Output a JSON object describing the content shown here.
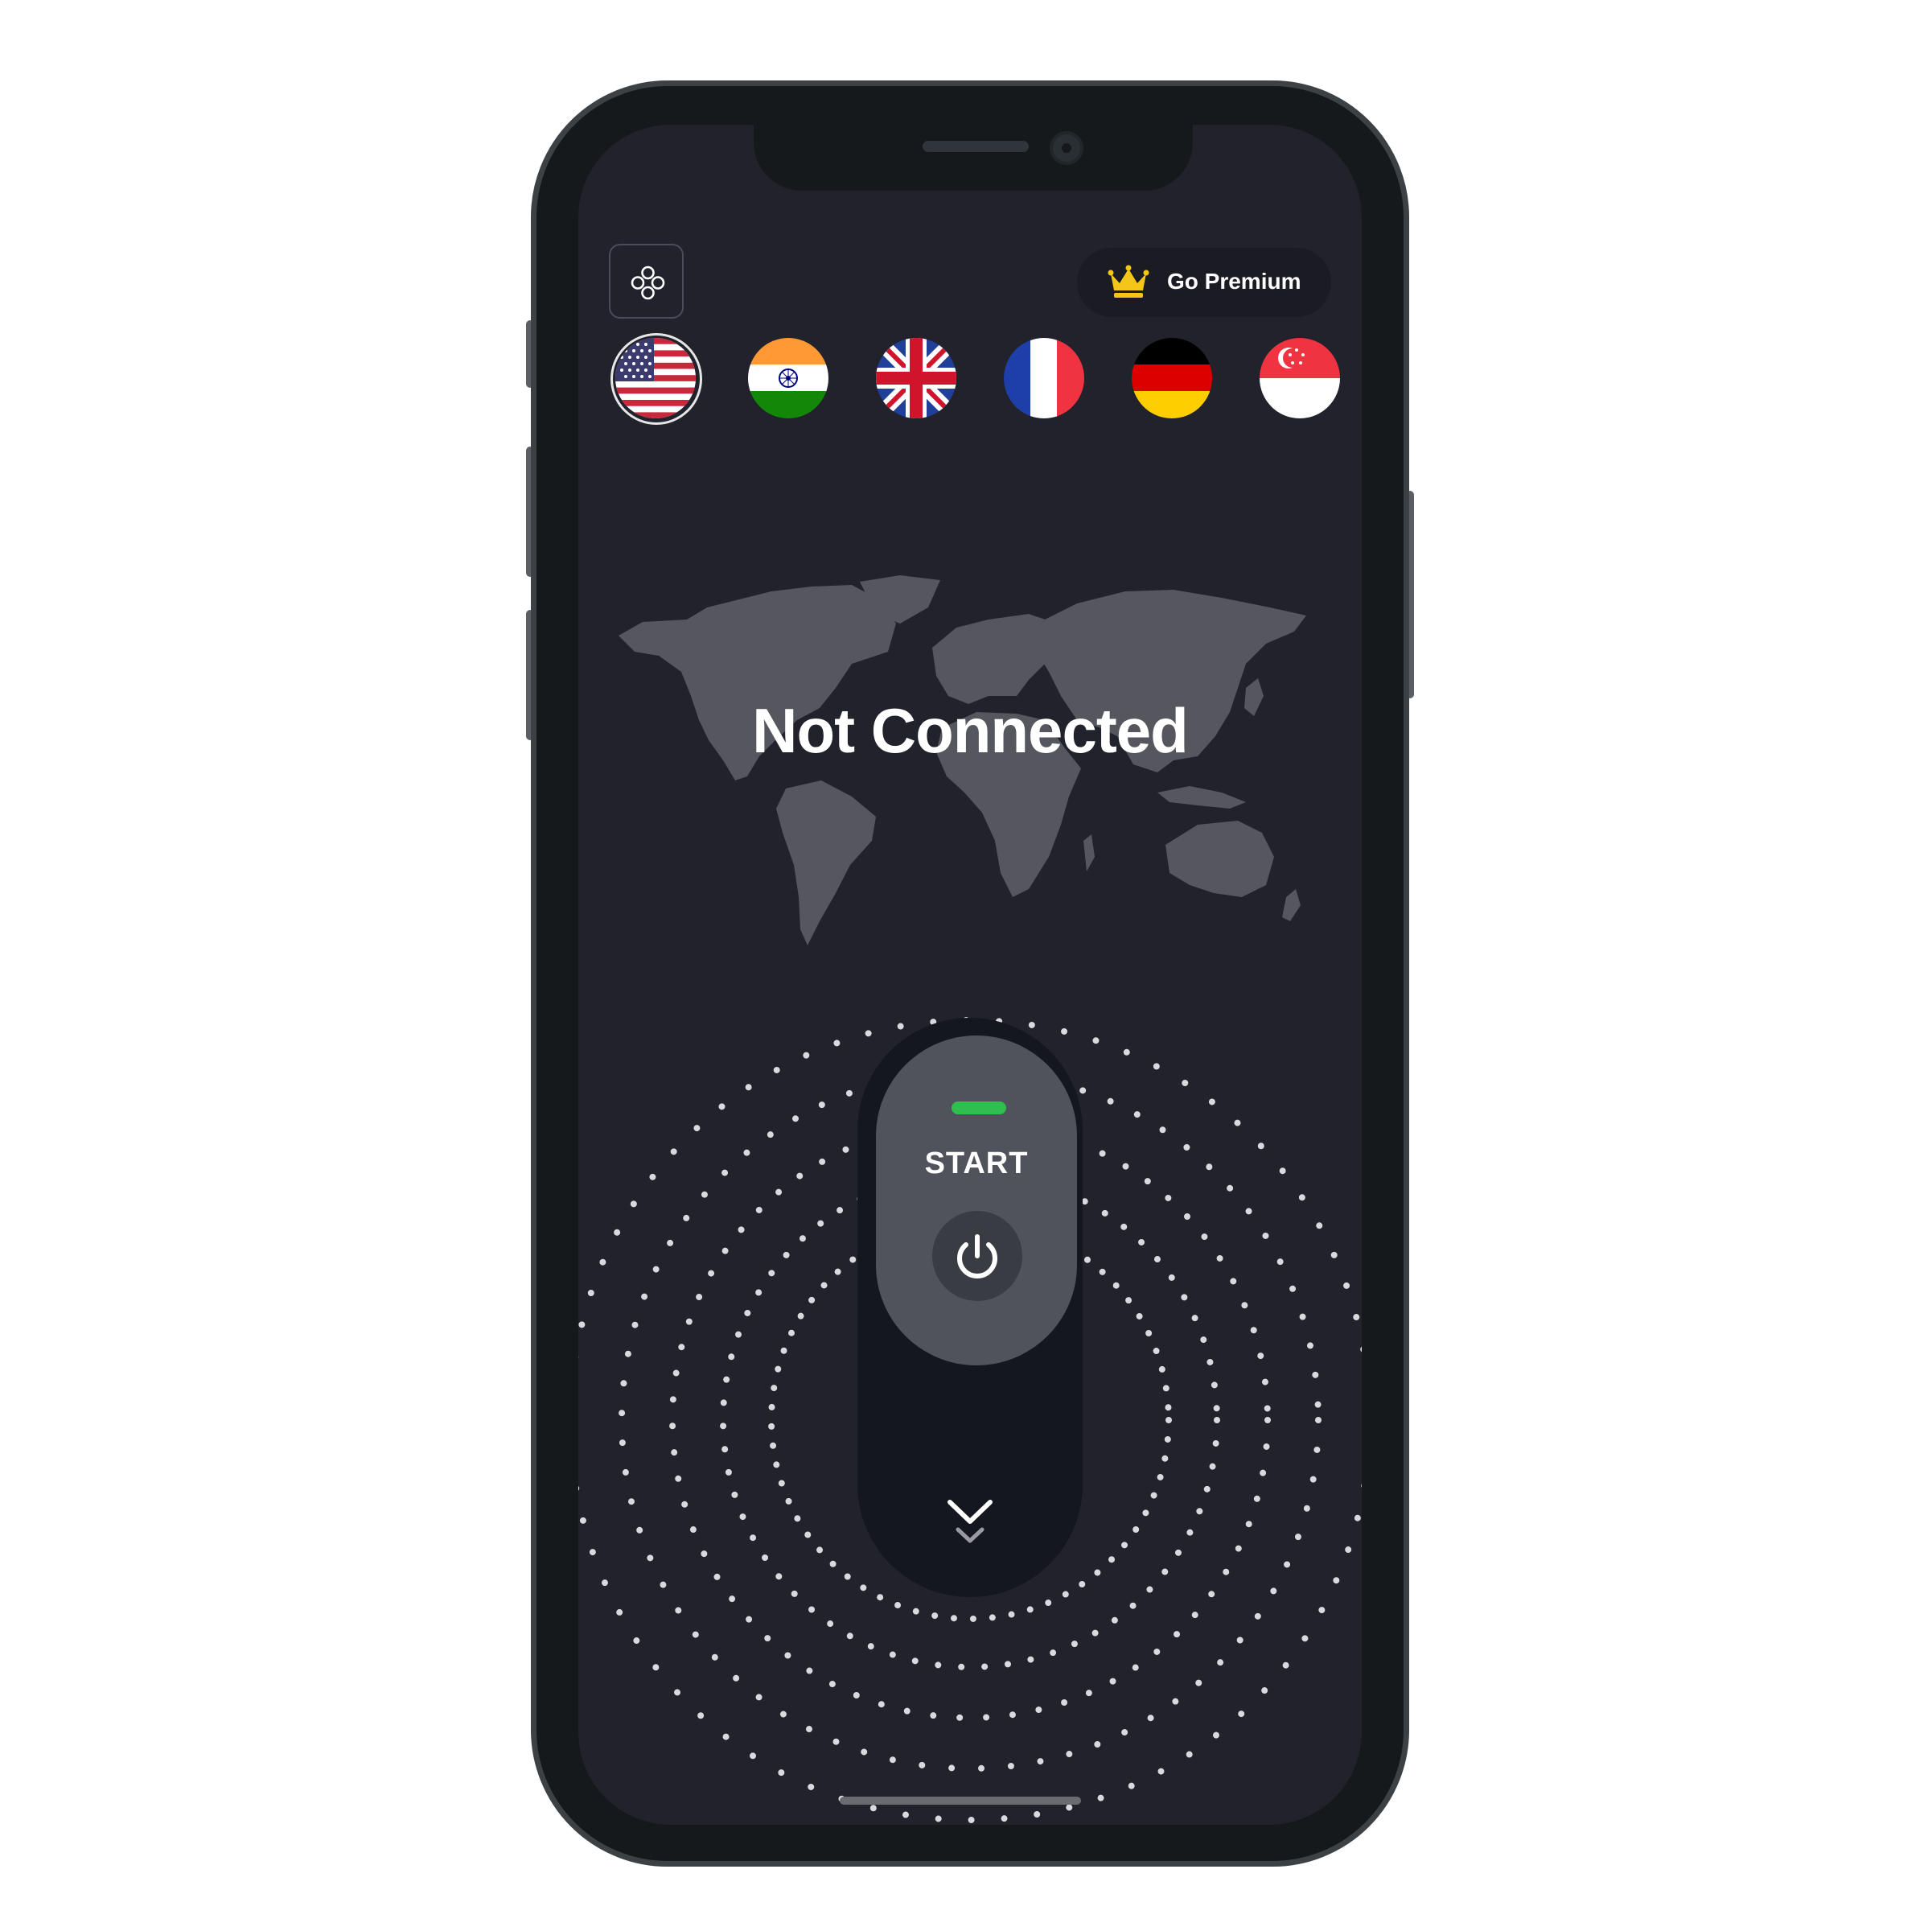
{
  "header": {
    "menu_icon": "apps-grid-icon",
    "premium_label": "Go Premium",
    "premium_icon": "crown-icon",
    "accent_color": "#f5c518"
  },
  "countries": [
    {
      "name": "United States",
      "icon": "us-flag-icon",
      "selected": true
    },
    {
      "name": "India",
      "icon": "india-flag-icon",
      "selected": false
    },
    {
      "name": "United Kingdom",
      "icon": "uk-flag-icon",
      "selected": false
    },
    {
      "name": "France",
      "icon": "france-flag-icon",
      "selected": false
    },
    {
      "name": "Germany",
      "icon": "germany-flag-icon",
      "selected": false
    },
    {
      "name": "Singapore",
      "icon": "singapore-flag-icon",
      "selected": false
    }
  ],
  "status": {
    "text": "Not Connected"
  },
  "switch": {
    "label": "START",
    "indicator_color": "#2fbf4f",
    "power_icon": "power-icon",
    "slide_icon": "double-chevron-down-icon"
  }
}
